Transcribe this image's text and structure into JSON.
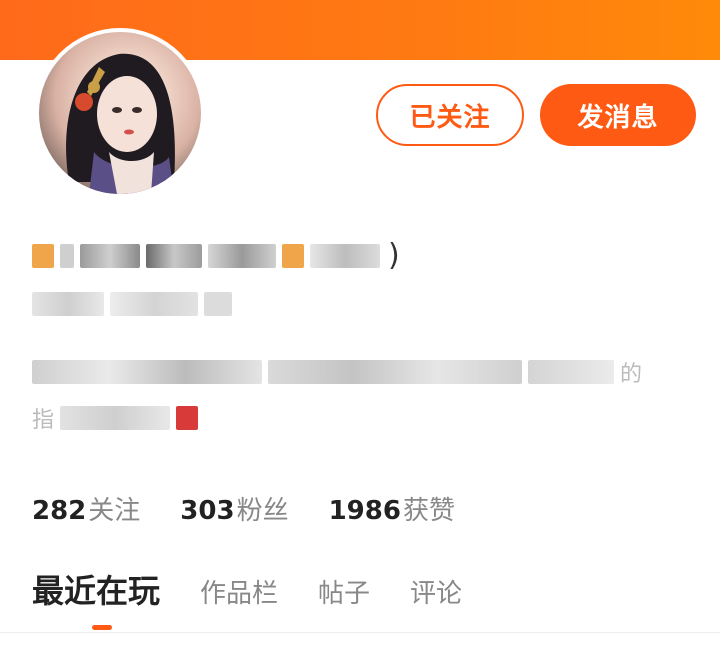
{
  "header": {
    "banner_color": "#ff6a1a"
  },
  "profile": {
    "avatar_icon": "user-avatar",
    "follow_label": "已关注",
    "message_label": "发消息",
    "name_tail": ")",
    "bio_char_1": "的",
    "bio_char_2": "指"
  },
  "stats": {
    "following_count": "282",
    "following_label": "关注",
    "followers_count": "303",
    "followers_label": "粉丝",
    "likes_count": "1986",
    "likes_label": "获赞"
  },
  "tabs": [
    {
      "label": "最近在玩"
    },
    {
      "label": "作品栏"
    },
    {
      "label": "帖子"
    },
    {
      "label": "评论"
    }
  ],
  "colors": {
    "accent": "#ff5a14"
  }
}
